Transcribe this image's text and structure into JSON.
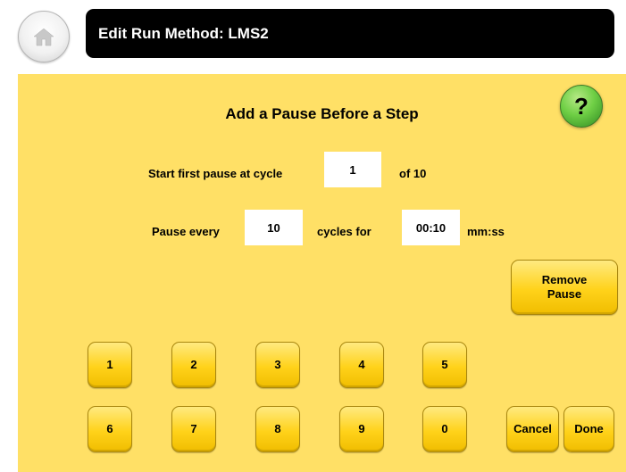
{
  "header": {
    "title": "Edit Run Method: LMS2",
    "home_icon": "home-icon"
  },
  "colors": {
    "title_bar": "#000000",
    "panel": "#ffe066",
    "button": "#ffd21a",
    "help_button": "#6fcf45"
  },
  "dialog": {
    "heading": "Add a Pause Before a Step",
    "help_label": "?",
    "start_label": "Start first pause at cycle",
    "start_value": "1",
    "start_suffix": "of 10",
    "pause_every_label": "Pause every",
    "pause_every_value": "10",
    "cycles_for_label": "cycles for",
    "duration_value": "00:10",
    "duration_unit": "mm:ss",
    "remove_pause_label": "Remove\nPause"
  },
  "keypad": {
    "keys": [
      "1",
      "2",
      "3",
      "4",
      "5",
      "6",
      "7",
      "8",
      "9",
      "0"
    ]
  },
  "actions": {
    "cancel_label": "Cancel",
    "done_label": "Done"
  }
}
